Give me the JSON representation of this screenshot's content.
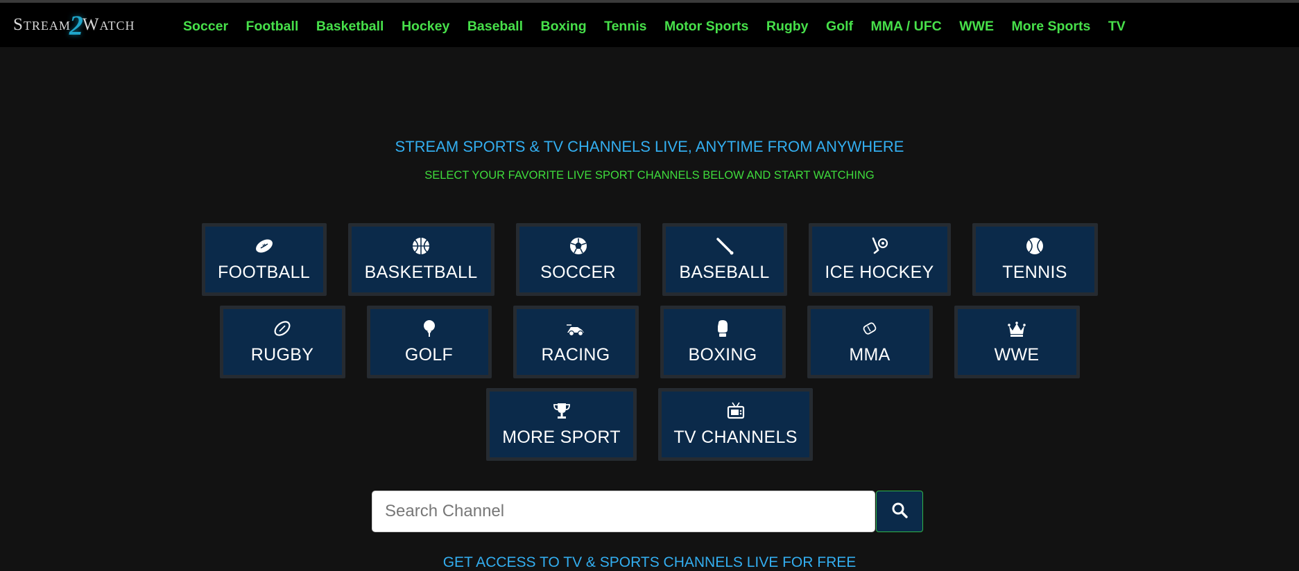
{
  "brand": {
    "left": "Stream",
    "mark": "2",
    "right": "Watch"
  },
  "nav": {
    "items": [
      {
        "label": "Soccer"
      },
      {
        "label": "Football"
      },
      {
        "label": "Basketball"
      },
      {
        "label": "Hockey"
      },
      {
        "label": "Baseball"
      },
      {
        "label": "Boxing"
      },
      {
        "label": "Tennis"
      },
      {
        "label": "Motor Sports"
      },
      {
        "label": "Rugby"
      },
      {
        "label": "Golf"
      },
      {
        "label": "MMA / UFC"
      },
      {
        "label": "WWE"
      },
      {
        "label": "More Sports"
      },
      {
        "label": "TV"
      }
    ]
  },
  "hero": {
    "headline": "STREAM SPORTS & TV CHANNELS LIVE, ANYTIME FROM ANYWHERE",
    "subline": "SELECT YOUR FAVORITE LIVE SPORT CHANNELS BELOW AND START WATCHING"
  },
  "tiles": {
    "football": {
      "label": "FOOTBALL",
      "icon": "football-icon"
    },
    "basketball": {
      "label": "BASKETBALL",
      "icon": "basketball-icon"
    },
    "soccer": {
      "label": "SOCCER",
      "icon": "soccer-ball-icon"
    },
    "baseball": {
      "label": "BASEBALL",
      "icon": "baseball-bat-icon"
    },
    "ice_hockey": {
      "label": "ICE HOCKEY",
      "icon": "hockey-stick-icon"
    },
    "tennis": {
      "label": "TENNIS",
      "icon": "tennis-ball-icon"
    },
    "rugby": {
      "label": "RUGBY",
      "icon": "rugby-ball-icon"
    },
    "golf": {
      "label": "GOLF",
      "icon": "golf-ball-icon"
    },
    "racing": {
      "label": "RACING",
      "icon": "racing-car-icon"
    },
    "boxing": {
      "label": "BOXING",
      "icon": "boxing-glove-icon"
    },
    "mma": {
      "label": "MMA",
      "icon": "mma-glove-icon"
    },
    "wwe": {
      "label": "WWE",
      "icon": "crown-icon"
    },
    "more_sport": {
      "label": "MORE SPORT",
      "icon": "trophy-icon"
    },
    "tv_channels": {
      "label": "TV CHANNELS",
      "icon": "tv-icon"
    }
  },
  "search": {
    "placeholder": "Search Channel",
    "value": "",
    "button_icon": "search-icon"
  },
  "footer": {
    "access_text": "GET ACCESS TO TV & SPORTS CHANNELS LIVE FOR FREE"
  },
  "colors": {
    "background": "#121212",
    "topbar": "#000000",
    "nav_link": "#47e04a",
    "headline": "#33aef0",
    "subline": "#3fdc3c",
    "tile_bg": "#0b2a4a",
    "tile_border": "#262b31"
  }
}
